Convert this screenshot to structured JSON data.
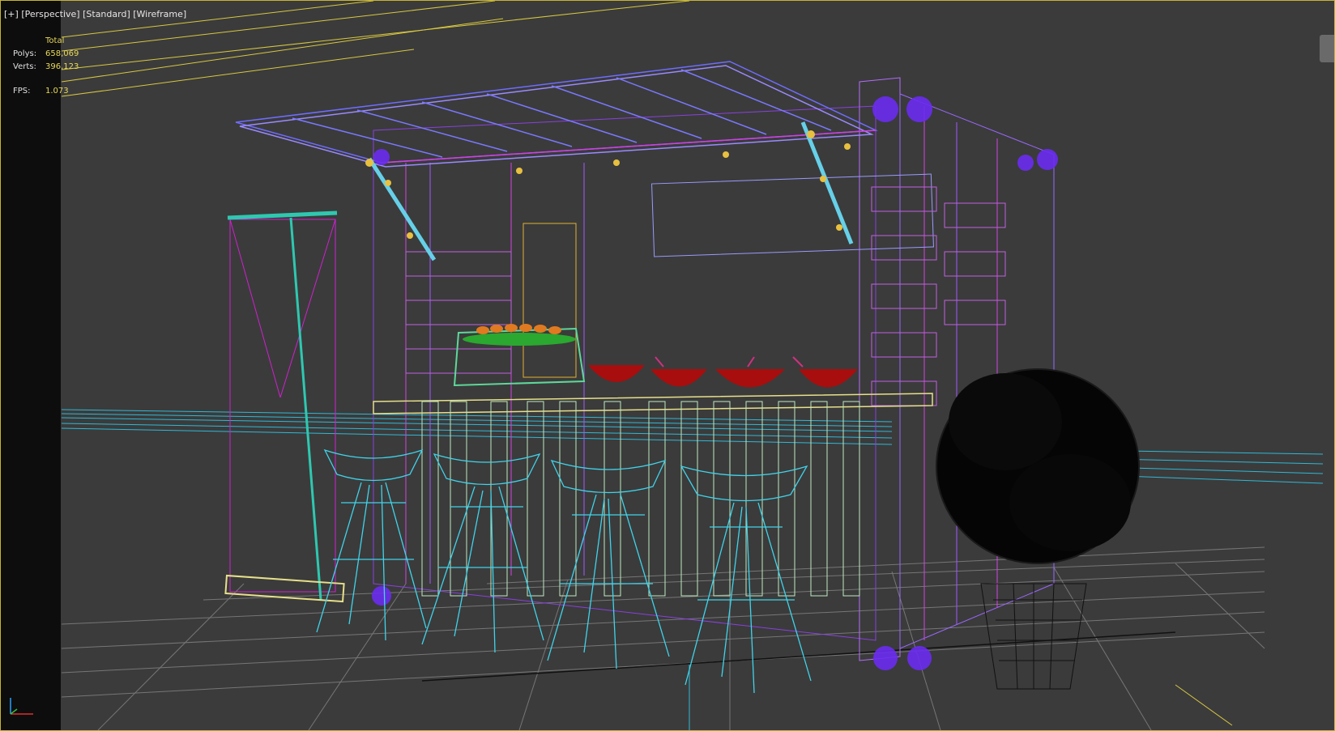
{
  "viewport": {
    "labels": [
      "[+]",
      "[Perspective]",
      "[Standard]",
      "[Wireframe]"
    ]
  },
  "stats": {
    "header": "Total",
    "polys_label": "Polys:",
    "polys_value": "658,069",
    "verts_label": "Verts:",
    "verts_value": "396,123",
    "fps_label": "FPS:",
    "fps_value": "1.073"
  },
  "colors": {
    "viewport_border": "#c8b430",
    "background": "#3b3b3b",
    "stats_value": "#e9d95a",
    "cyan_wire": "#3fd4ea",
    "purple_wire": "#7a5bff",
    "magenta_wire": "#e040e6",
    "bowl_red": "#b01010"
  },
  "icons": {
    "axis_gizmo": "axis-tripod-icon",
    "nav_widget": "viewcube-icon"
  }
}
